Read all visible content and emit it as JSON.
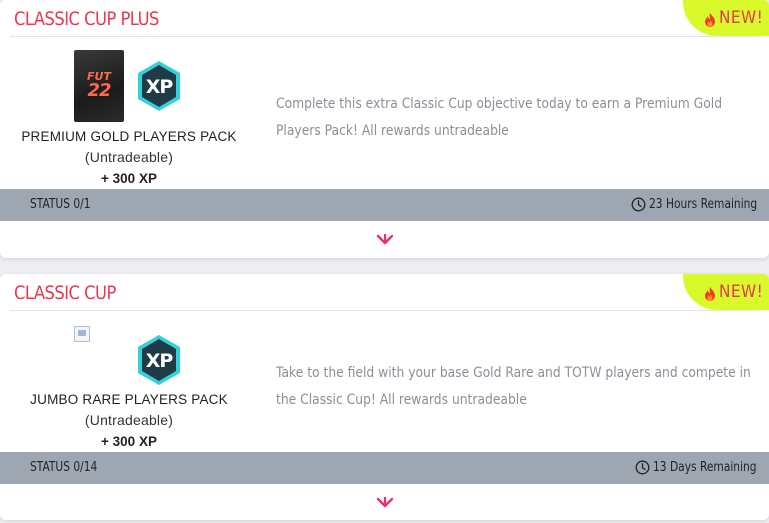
{
  "cards": [
    {
      "title": "CLASSIC CUP PLUS",
      "badge": "NEW!",
      "reward_name": "PREMIUM GOLD PLAYERS PACK",
      "reward_sub": "(Untradeable)",
      "reward_xp": "+ 300 XP",
      "pack_label_1": "FUT",
      "pack_label_2": "22",
      "description": "Complete this extra Classic Cup objective today to earn a Premium Gold Players Pack! All rewards untradeable",
      "status": "STATUS 0/1",
      "remaining": "23 Hours Remaining",
      "icons": [
        "flame-icon",
        "pack-image",
        "xp-icon",
        "clock-icon",
        "chevron-down-icon"
      ]
    },
    {
      "title": "CLASSIC CUP",
      "badge": "NEW!",
      "reward_name": "JUMBO RARE PLAYERS PACK",
      "reward_sub": "(Untradeable)",
      "reward_xp": "+ 300 XP",
      "description": "Take to the field with your base Gold Rare and TOTW players and compete in the Classic Cup! All rewards untradeable",
      "status": "STATUS 0/14",
      "remaining": "13 Days Remaining",
      "icons": [
        "flame-icon",
        "broken-image-icon",
        "xp-icon",
        "clock-icon",
        "chevron-down-icon"
      ]
    }
  ],
  "colors": {
    "title": "#e8384f",
    "badge_bg": "#d9f92b",
    "status_bar": "#9ea7b1",
    "chevron": "#e8306a",
    "xp_fill": "#1f3b45",
    "xp_ring": "#35d0d8"
  }
}
